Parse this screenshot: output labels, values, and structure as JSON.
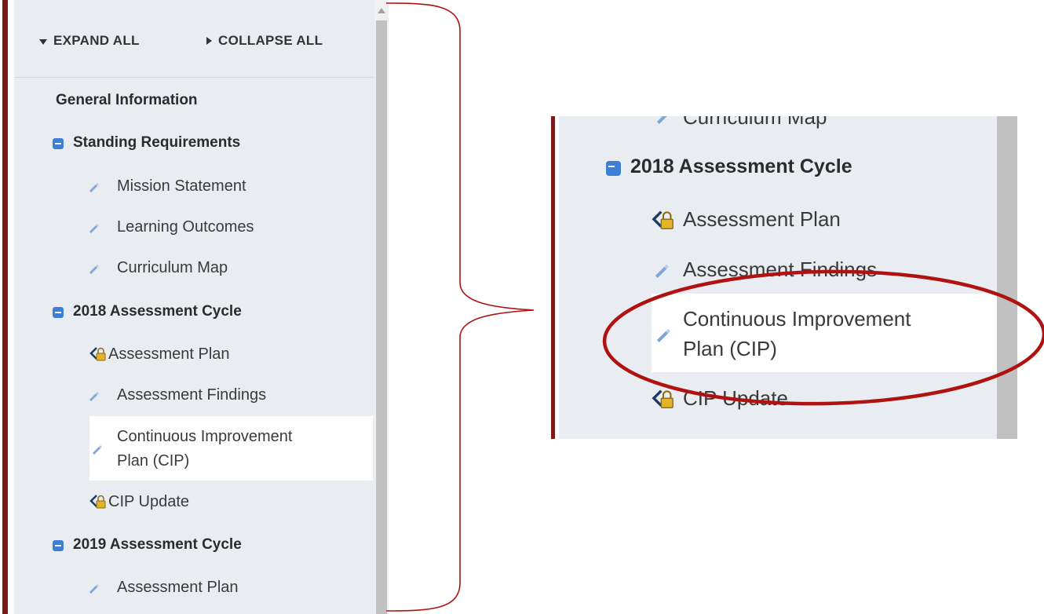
{
  "toolbar": {
    "expand_all": "EXPAND ALL",
    "collapse_all": "COLLAPSE ALL"
  },
  "tree": {
    "general_information": "General Information",
    "standing_requirements": {
      "label": "Standing Requirements",
      "items": [
        "Mission Statement",
        "Learning Outcomes",
        "Curriculum Map"
      ]
    },
    "cycle_2018": {
      "label": "2018 Assessment Cycle",
      "items": [
        "Assessment Plan",
        "Assessment Findings",
        "Continuous Improvement",
        "Plan (CIP)",
        "CIP Update"
      ]
    },
    "cycle_2019": {
      "label": "2019 Assessment Cycle",
      "items": [
        "Assessment Plan"
      ]
    }
  },
  "zoom": {
    "partial_item": "Curriculum Map",
    "heading": "2018 Assessment Cycle",
    "items": [
      "Assessment Plan",
      "Assessment Findings",
      "Continuous Improvement",
      "Plan (CIP)",
      "CIP Update"
    ]
  },
  "colors": {
    "accent_border": "#7a1a1a",
    "minus_icon": "#3d7fd6",
    "annotation": "#b01212",
    "panel_bg": "#e9ecf1",
    "selected_bg": "#ffffff"
  },
  "icons": {
    "toggle": "minus-square-icon",
    "editable": "pencil-icon",
    "locked": "locked-pencil-icon"
  }
}
